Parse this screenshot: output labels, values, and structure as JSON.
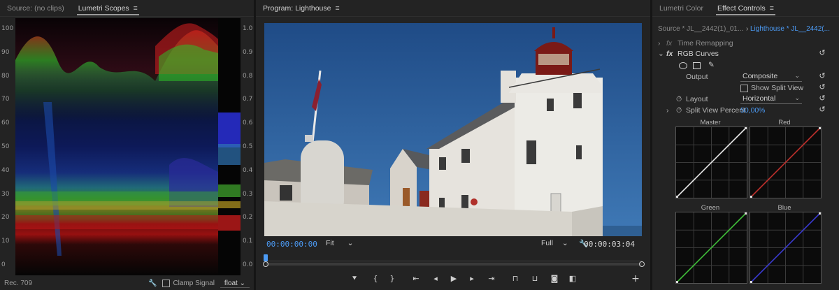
{
  "scopes_panel": {
    "tabs": [
      {
        "label": "Source: (no clips)",
        "active": false
      },
      {
        "label": "Lumetri Scopes",
        "active": true
      }
    ],
    "left_axis": [
      "100",
      "90",
      "80",
      "70",
      "60",
      "50",
      "40",
      "30",
      "20",
      "10",
      "0"
    ],
    "right_axis": [
      "1.0",
      "0.9",
      "0.8",
      "0.7",
      "0.6",
      "0.5",
      "0.4",
      "0.3",
      "0.2",
      "0.1",
      "0.0"
    ],
    "color_space": "Rec. 709",
    "clamp_signal_label": "Clamp Signal",
    "clamp_signal_checked": false,
    "precision_value": "float"
  },
  "program_panel": {
    "title": "Program: Lighthouse",
    "current_timecode": "00:00:00:00",
    "fit_value": "Fit",
    "quality_value": "Full",
    "duration_timecode": "00:00:03:04",
    "playhead_fraction": 0.0
  },
  "effects_panel": {
    "tabs": [
      {
        "label": "Lumetri Color",
        "active": false
      },
      {
        "label": "Effect Controls",
        "active": true
      }
    ],
    "source_label": "Source * JL__2442(1)_01...",
    "sequence_label": "Lighthouse * JL__2442(...",
    "time_remapping_label": "Time Remapping",
    "effect_name": "RGB Curves",
    "output_label": "Output",
    "output_value": "Composite",
    "show_split_view_label": "Show Split View",
    "show_split_view_checked": false,
    "layout_label": "Layout",
    "layout_value": "Horizontal",
    "split_percent_label": "Split View Percent",
    "split_percent_value": "50,00",
    "split_percent_unit": "%",
    "curves": [
      {
        "name": "Master",
        "color": "#e8e8e8"
      },
      {
        "name": "Red",
        "color": "#c0302c"
      },
      {
        "name": "Green",
        "color": "#3fbf3a"
      },
      {
        "name": "Blue",
        "color": "#3a3acf"
      }
    ]
  },
  "colors": {
    "accent_blue": "#4c9bf5",
    "panel_bg": "#232323"
  }
}
